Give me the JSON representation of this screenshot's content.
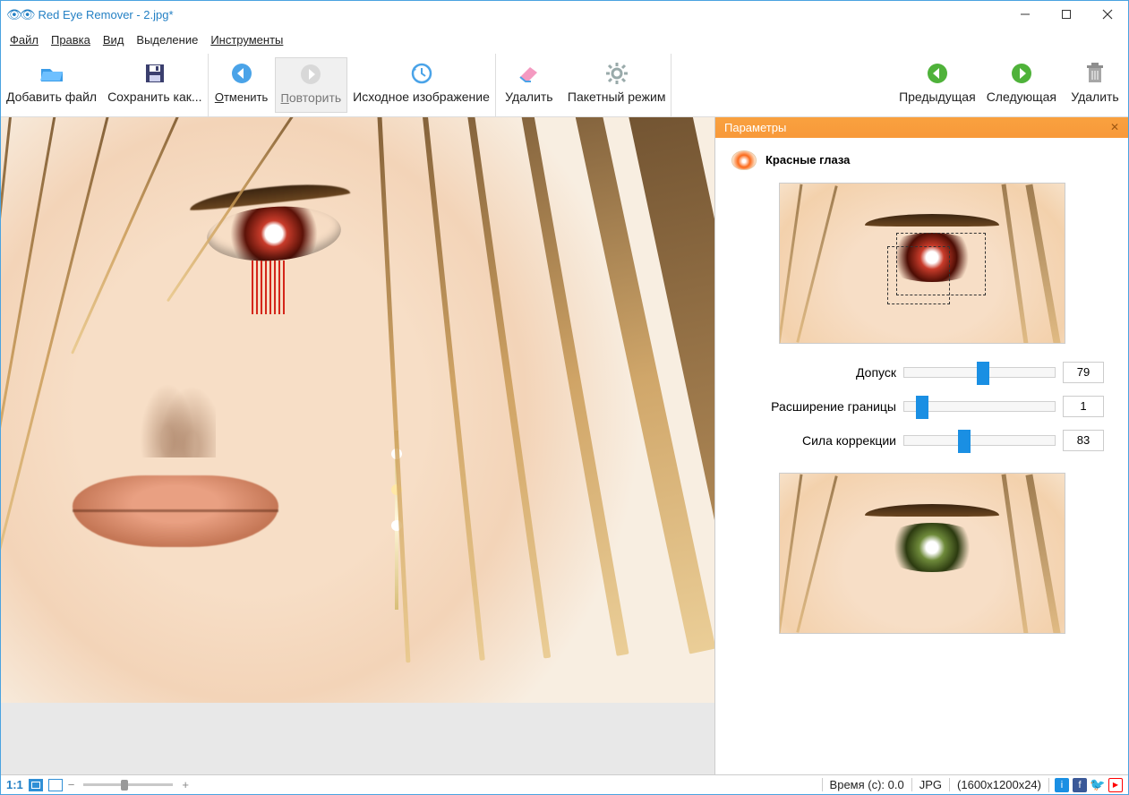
{
  "window": {
    "title": "Red Eye Remover - 2.jpg*"
  },
  "menu": {
    "file": "Файл",
    "edit": "Правка",
    "view": "Вид",
    "selection": "Выделение",
    "tools": "Инструменты"
  },
  "toolbar": {
    "add_file": "Добавить файл",
    "save_as": "Сохранить как...",
    "undo": "Отменить",
    "redo": "Повторить",
    "original": "Исходное изображение",
    "delete": "Удалить",
    "batch": "Пакетный режим",
    "prev": "Предыдущая",
    "next": "Следующая",
    "remove": "Удалить"
  },
  "panel": {
    "header": "Параметры",
    "title": "Красные глаза",
    "sliders": {
      "tolerance": {
        "label": "Допуск",
        "value": "79",
        "pct": 48
      },
      "expand": {
        "label": "Расширение границы",
        "value": "1",
        "pct": 8
      },
      "strength": {
        "label": "Сила коррекции",
        "value": "83",
        "pct": 36
      }
    }
  },
  "status": {
    "zoom_label": "1:1",
    "time": "Время (с): 0.0",
    "format": "JPG",
    "dims": "(1600x1200x24)"
  }
}
